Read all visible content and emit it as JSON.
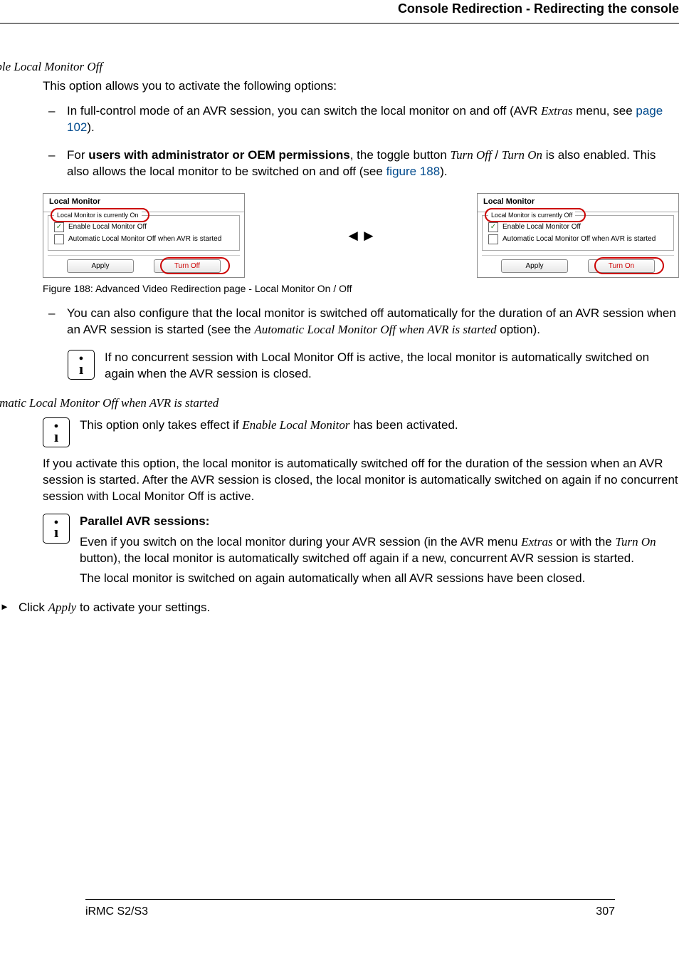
{
  "header": {
    "running": "Console Redirection - Redirecting the console"
  },
  "sec1": {
    "heading": "Enable Local Monitor Off",
    "intro": "This option allows you to activate the following options:",
    "bullet1a": "In full-control mode of an AVR session, you can switch the local monitor on and off (AVR ",
    "bullet1b": "Extras",
    "bullet1c": " menu, see ",
    "bullet1link": "page 102",
    "bullet1d": ").",
    "bullet2a": "For ",
    "bullet2bold": "users with administrator or OEM permissions",
    "bullet2b": ", the toggle button ",
    "bullet2it1": "Turn Off",
    "bullet2sep": " / ",
    "bullet2it2": "Turn On",
    "bullet2c": " is also enabled. This also allows the local monitor to be switched on and off (see ",
    "bullet2link": "figure 188",
    "bullet2d": ")."
  },
  "fig": {
    "panelTitle": "Local Monitor",
    "legendOn": "Local Monitor is currently On",
    "legendOff": "Local Monitor is currently Off",
    "chk1": "Enable Local Monitor Off",
    "chk2": "Automatic Local Monitor Off when AVR is started",
    "apply": "Apply",
    "turnOff": "Turn Off",
    "turnOn": "Turn On",
    "caption": "Figure 188: Advanced Video Redirection page - Local Monitor On / Off"
  },
  "afterFig": {
    "bullet3a": "You can also configure that the local monitor is switched off automatically for the duration of an AVR session when an AVR session is started (see the ",
    "bullet3it": "Automatic Local Monitor Off when AVR is started",
    "bullet3b": " option).",
    "info1": "If no concurrent session with Local Monitor Off is active, the local monitor is automatically switched on again when the AVR session is closed."
  },
  "sec2": {
    "heading": "Automatic Local Monitor Off when AVR is started",
    "info2a": "This option only takes effect if ",
    "info2it": "Enable Local Monitor",
    "info2b": " has been activated.",
    "para": "If you activate this option, the local monitor is automatically switched off for the duration of the session when an AVR session is started. After the AVR session is closed, the local monitor is automatically switched on again if no concurrent session with Local Monitor Off is active.",
    "info3title": "Parallel AVR sessions:",
    "info3a": "Even if you switch on the local monitor during your AVR session (in the AVR menu ",
    "info3it1": "Extras",
    "info3b": " or with the ",
    "info3it2": "Turn On",
    "info3c": " button), the local monitor is automatically switched off again if a new, concurrent AVR session is started.",
    "info3d": "The local monitor is switched on again automatically when all AVR sessions have been closed.",
    "actionA": "Click ",
    "actionIt": "Apply",
    "actionB": " to activate your settings."
  },
  "footer": {
    "left": "iRMC S2/S3",
    "right": "307"
  }
}
